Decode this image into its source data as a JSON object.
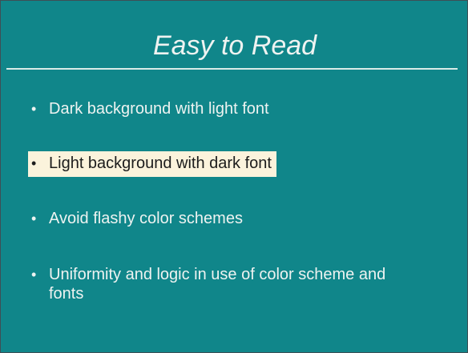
{
  "slide": {
    "title": "Easy to Read",
    "bullet_glyph": "•",
    "bullets": [
      {
        "text": "Dark background with light font",
        "highlighted": false
      },
      {
        "text": "Light background with dark font",
        "highlighted": true
      },
      {
        "text": "Avoid flashy color schemes",
        "highlighted": false
      },
      {
        "text": "Uniformity and logic in use of color scheme and fonts",
        "highlighted": false
      }
    ]
  },
  "colors": {
    "background": "#10868a",
    "text": "#eef3f1",
    "highlight_background": "#fbf3dc",
    "highlight_text": "#1c1c1c"
  }
}
